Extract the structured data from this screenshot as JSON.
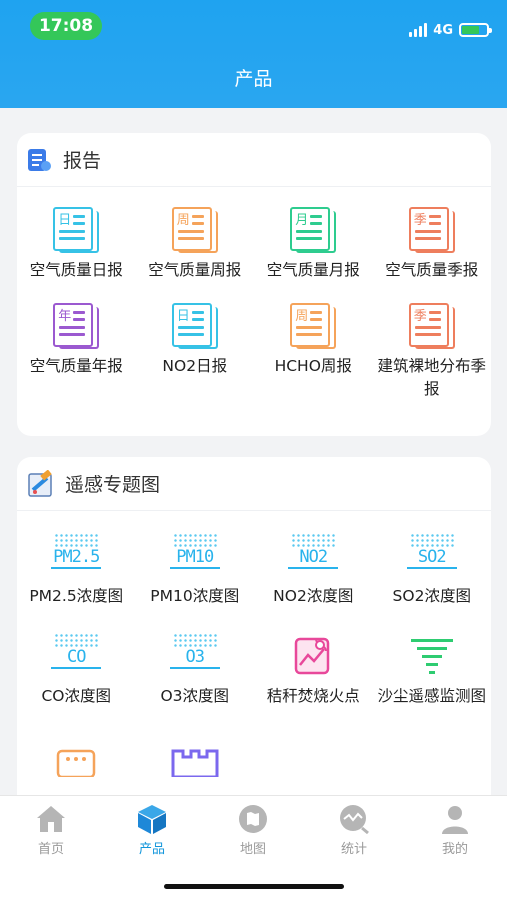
{
  "status": {
    "time": "17:08",
    "network": "4G"
  },
  "header": {
    "title": "产品"
  },
  "reports": {
    "title": "报告",
    "items": [
      {
        "label": "空气质量日报",
        "char": "日",
        "color": "#36c2e6"
      },
      {
        "label": "空气质量周报",
        "char": "周",
        "color": "#f5a35a"
      },
      {
        "label": "空气质量月报",
        "char": "月",
        "color": "#2ecc8f"
      },
      {
        "label": "空气质量季报",
        "char": "季",
        "color": "#ee7e5d"
      },
      {
        "label": "空气质量年报",
        "char": "年",
        "color": "#9b59d0"
      },
      {
        "label": "NO2日报",
        "char": "日",
        "color": "#36c2e6"
      },
      {
        "label": "HCHO周报",
        "char": "周",
        "color": "#f5a35a"
      },
      {
        "label": "建筑裸地分布季报",
        "char": "季",
        "color": "#ee7e5d"
      }
    ]
  },
  "remote": {
    "title": "遥感专题图",
    "items": [
      {
        "label": "PM2.5浓度图",
        "code": "PM2.5"
      },
      {
        "label": "PM10浓度图",
        "code": "PM10"
      },
      {
        "label": "NO2浓度图",
        "code": "NO2"
      },
      {
        "label": "SO2浓度图",
        "code": "SO2"
      },
      {
        "label": "CO浓度图",
        "code": "CO"
      },
      {
        "label": "O3浓度图",
        "code": "O3"
      },
      {
        "label": "秸秆焚烧火点",
        "icon": "fire-map-icon"
      },
      {
        "label": "沙尘遥感监测图",
        "icon": "dust-funnel-icon"
      }
    ]
  },
  "tabs": [
    {
      "label": "首页",
      "icon": "home-icon"
    },
    {
      "label": "产品",
      "icon": "cube-icon"
    },
    {
      "label": "地图",
      "icon": "map-icon"
    },
    {
      "label": "统计",
      "icon": "chart-icon"
    },
    {
      "label": "我的",
      "icon": "user-icon"
    }
  ],
  "colors": {
    "accent": "#1296db",
    "header": "#1fa3f0",
    "remote": "#29b3ec"
  }
}
